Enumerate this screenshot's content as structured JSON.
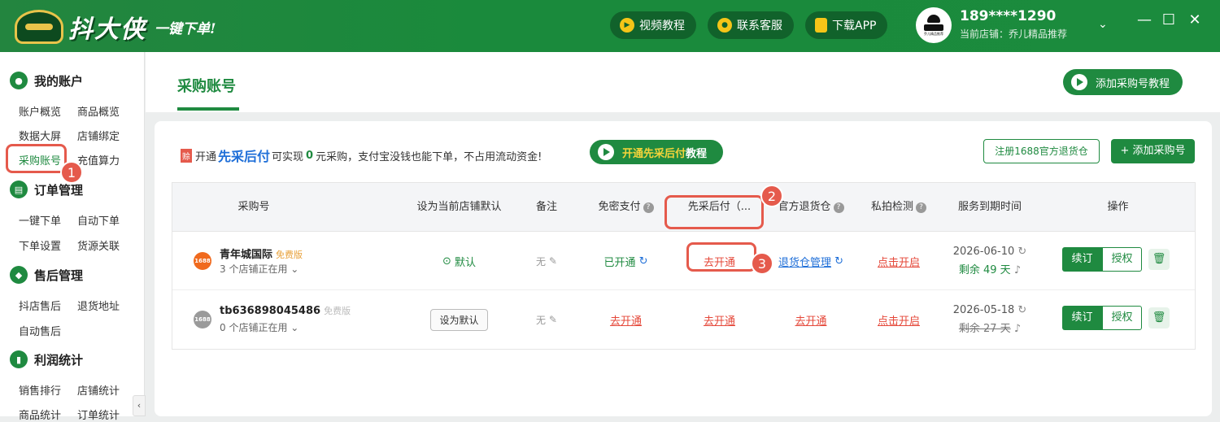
{
  "header": {
    "brand": "抖大侠",
    "slogan": "一键下单!",
    "buttons": [
      {
        "label": "视频教程",
        "icon": "play-icon"
      },
      {
        "label": "联系客服",
        "icon": "chat-icon"
      },
      {
        "label": "下载APP",
        "icon": "phone-icon"
      }
    ],
    "user_phone": "189****1290",
    "current_store": "当前店铺：乔儿精品推荐",
    "avatar_text": "乔儿精品推荐"
  },
  "sidebar": {
    "sections": [
      {
        "title": "我的账户",
        "items": [
          "账户概览",
          "商品概览",
          "数据大屏",
          "店铺绑定",
          "采购账号",
          "充值算力"
        ]
      },
      {
        "title": "订单管理",
        "items": [
          "一键下单",
          "自动下单",
          "下单设置",
          "货源关联"
        ]
      },
      {
        "title": "售后管理",
        "items": [
          "抖店售后",
          "退货地址",
          "自动售后"
        ]
      },
      {
        "title": "利润统计",
        "items": [
          "销售排行",
          "店铺统计",
          "商品统计",
          "订单统计"
        ]
      }
    ],
    "active_item": "采购账号"
  },
  "main": {
    "page_title": "采购账号",
    "tutorial_button": "添加采购号教程",
    "promo": {
      "tag": "赊",
      "prefix": "开通",
      "highlight": "先采后付",
      "middle": "可实现",
      "zero": "0",
      "suffix": "元采购，支付宝没钱也能下单，不占用流动资金!",
      "button_highlight": "开通先采后付",
      "button_suffix": "教程"
    },
    "register_button": "注册1688官方退货仓",
    "add_button": "+ 添加采购号",
    "table": {
      "headers": [
        "采购号",
        "设为当前店铺默认",
        "备注",
        "免密支付",
        "先采后付（...",
        "官方退货仓",
        "私拍检测",
        "服务到期时间",
        "操作"
      ],
      "rows": [
        {
          "name": "青年城国际",
          "plan": "免费版",
          "stores": "3 个店铺正在用",
          "default": "默认",
          "note": "无",
          "pwdfree": "已开通",
          "paylater": "去开通",
          "return_wh": "退货仓管理",
          "private": "点击开启",
          "expiry": "2026-06-10",
          "remaining": "剩余 49 天",
          "renew": "续订",
          "auth": "授权"
        },
        {
          "name": "tb636898045486",
          "plan": "免费版",
          "stores": "0 个店铺正在用",
          "default": "设为默认",
          "note": "无",
          "pwdfree": "去开通",
          "paylater": "去开通",
          "return_wh": "去开通",
          "private": "点击开启",
          "expiry": "2026-05-18",
          "remaining": "剩余 27 天",
          "renew": "续订",
          "auth": "授权"
        }
      ]
    }
  },
  "annotations": [
    "1",
    "2",
    "3"
  ],
  "colors": {
    "primary": "#1f8a40",
    "danger": "#e5483a",
    "link": "#1f6fd8",
    "callout": "#e55a4c"
  }
}
